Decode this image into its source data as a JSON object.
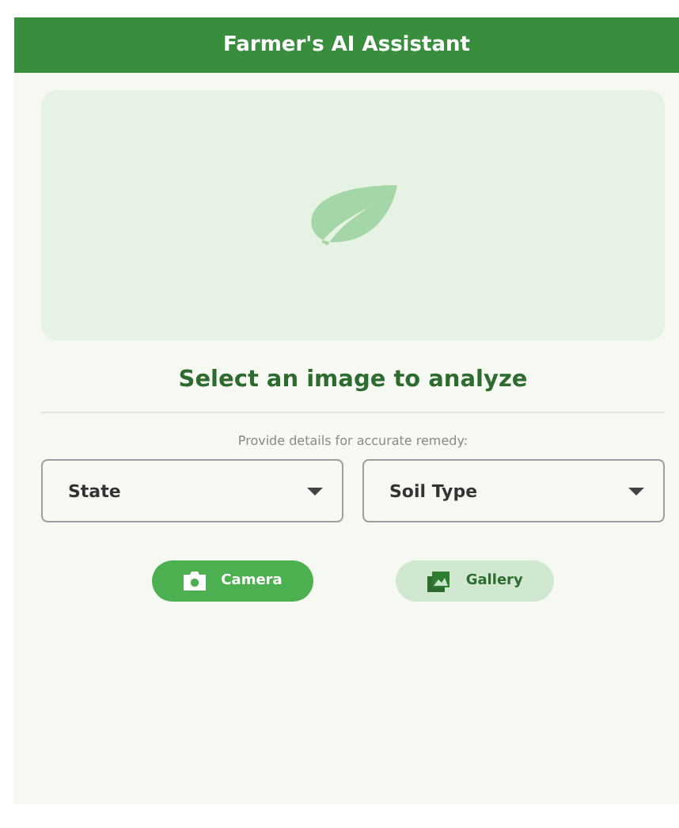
{
  "app_bar": {
    "title": "Farmer's AI Assistant"
  },
  "image_area": {
    "kind": "empty"
  },
  "prompt": "Select an image to analyze",
  "details_hint": "Provide details for accurate remedy:",
  "dropdowns": [
    {
      "label": "State"
    },
    {
      "label": "Soil Type"
    }
  ],
  "buttons": [
    {
      "label": "Camera",
      "kind": "filled"
    },
    {
      "label": "Gallery",
      "kind": "tonal"
    }
  ]
}
